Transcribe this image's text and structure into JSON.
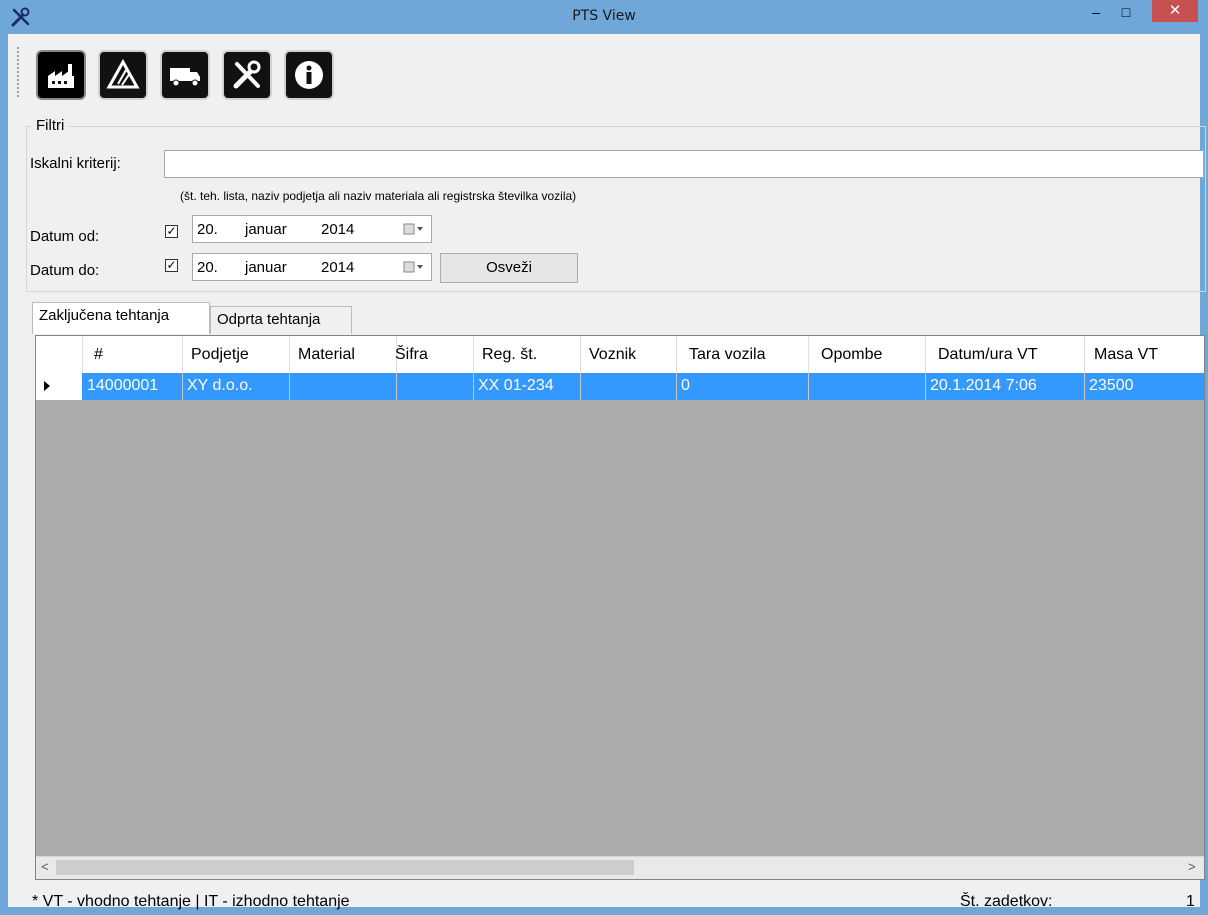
{
  "window": {
    "title": "PTS View",
    "min_glyph": "–",
    "max_glyph": "□",
    "close_glyph": "✕"
  },
  "toolbar": {
    "buttons": [
      {
        "icon": "factory-icon"
      },
      {
        "icon": "road-warning-icon"
      },
      {
        "icon": "truck-icon"
      },
      {
        "icon": "tools-icon"
      },
      {
        "icon": "info-icon"
      }
    ]
  },
  "filters": {
    "legend": "Filtri",
    "search_label": "Iskalni kriterij:",
    "search_value": "",
    "hint": "(št. teh. lista, naziv podjetja ali naziv materiala ali registrska številka vozila)",
    "date_from": {
      "label": "Datum od:",
      "checked": "✓",
      "day": "20.",
      "month": "januar",
      "year": "2014"
    },
    "date_to": {
      "label": "Datum do:",
      "checked": "✓",
      "day": "20.",
      "month": "januar",
      "year": "2014"
    },
    "refresh_label": "Osveži"
  },
  "tabs": [
    {
      "label": "Zaključena tehtanja",
      "active": true
    },
    {
      "label": "Odprta tehtanja",
      "active": false
    }
  ],
  "grid": {
    "columns": [
      "#",
      "Podjetje",
      "Material",
      "Šifra",
      "Reg. št.",
      "Voznik",
      "Tara vozila",
      "Opombe",
      "Datum/ura VT",
      "Masa VT"
    ],
    "rows": [
      [
        "14000001",
        "XY d.o.o.",
        "",
        "",
        "XX 01-234",
        "",
        "0",
        "",
        "20.1.2014 7:06",
        "23500"
      ]
    ],
    "scroll_left": "<",
    "scroll_right": ">"
  },
  "status": {
    "legend": "* VT - vhodno tehtanje | IT - izhodno tehtanje",
    "count_label": "Št. zadetkov:",
    "count_value": "1"
  },
  "colors": {
    "selection": "#3399ff",
    "titlebar": "#6fa7d9",
    "close": "#c75050",
    "grid_background": "#ababab"
  }
}
